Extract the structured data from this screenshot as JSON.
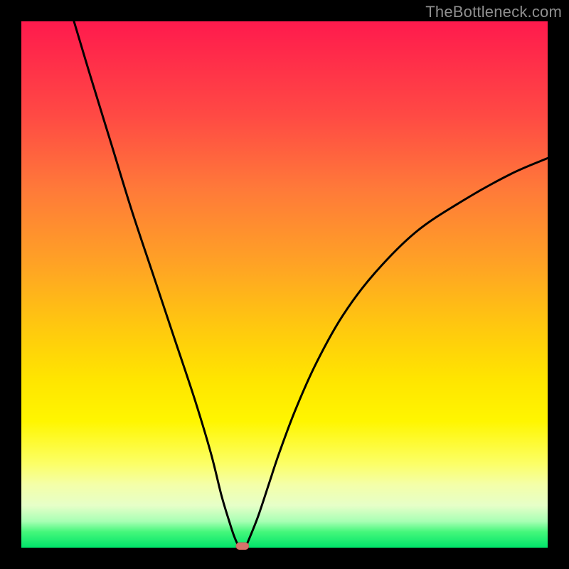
{
  "watermark": "TheBottleneck.com",
  "chart_data": {
    "type": "line",
    "title": "",
    "xlabel": "",
    "ylabel": "",
    "x_range": [
      0,
      100
    ],
    "y_range": [
      0,
      100
    ],
    "series": [
      {
        "name": "curve",
        "x": [
          10,
          13,
          17,
          21,
          25,
          29,
          33,
          36,
          38,
          39.5,
          40.5,
          41.5,
          42.5,
          43,
          45,
          47,
          49,
          52,
          56,
          61,
          67,
          75,
          84,
          93,
          100
        ],
        "y": [
          100,
          90,
          77,
          64,
          52,
          40,
          28,
          18,
          10,
          5,
          2,
          0,
          0,
          1,
          6,
          12,
          18,
          26,
          35,
          44,
          52,
          60,
          66,
          71,
          74
        ]
      }
    ],
    "minimum_marker": {
      "x": 42,
      "y": 0.3
    },
    "background_gradient": {
      "top": "#ff1a4d",
      "mid": "#ffe500",
      "bottom": "#00e46a"
    }
  }
}
